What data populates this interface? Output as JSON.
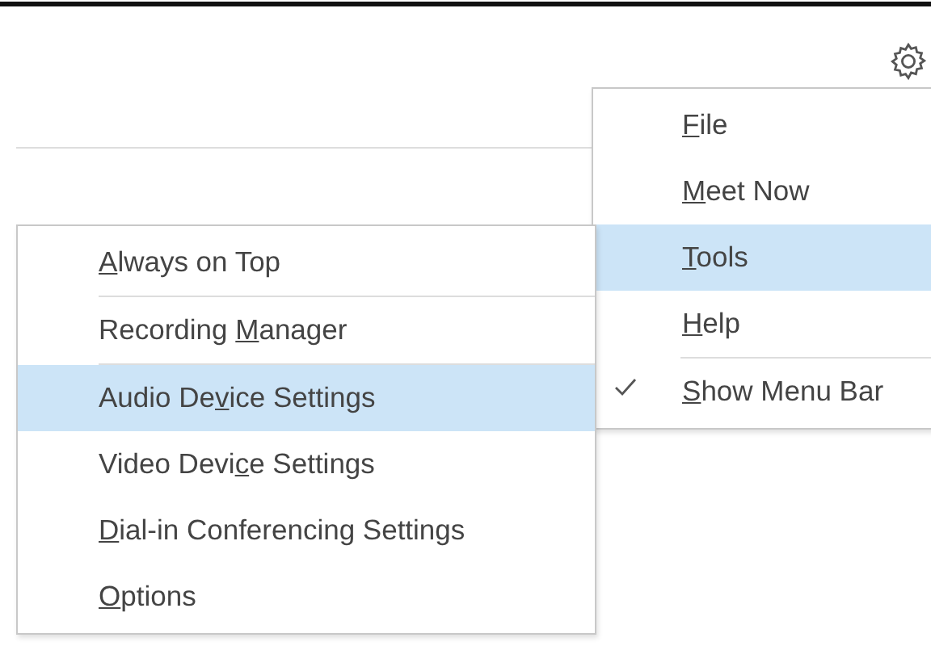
{
  "main_menu": [
    {
      "kind": "item",
      "access_key": "F",
      "label_after": "ile",
      "selected": false,
      "checked": false
    },
    {
      "kind": "item",
      "access_key": "M",
      "label_after": "eet Now",
      "selected": false,
      "checked": false
    },
    {
      "kind": "item",
      "access_key": "T",
      "label_after": "ools",
      "selected": true,
      "checked": false
    },
    {
      "kind": "item",
      "access_key": "H",
      "label_after": "elp",
      "selected": false,
      "checked": false
    },
    {
      "kind": "separator"
    },
    {
      "kind": "item",
      "access_key": "S",
      "label_after": "how Menu Bar",
      "selected": false,
      "checked": true
    }
  ],
  "tools_submenu": [
    {
      "kind": "item",
      "access_key": "A",
      "label_after": "lways on Top",
      "selected": false
    },
    {
      "kind": "separator"
    },
    {
      "kind": "item",
      "label_before": "Recording ",
      "access_key": "M",
      "label_after": "anager",
      "selected": false
    },
    {
      "kind": "separator"
    },
    {
      "kind": "item",
      "label_before": "Audio De",
      "access_key": "v",
      "label_after": "ice Settings",
      "selected": true
    },
    {
      "kind": "item",
      "label_before": "Video Devi",
      "access_key": "c",
      "label_after": "e Settings",
      "selected": false
    },
    {
      "kind": "item",
      "access_key": "D",
      "label_after": "ial-in Conferencing Settings",
      "selected": false
    },
    {
      "kind": "item",
      "access_key": "O",
      "label_after": "ptions",
      "selected": false
    }
  ]
}
